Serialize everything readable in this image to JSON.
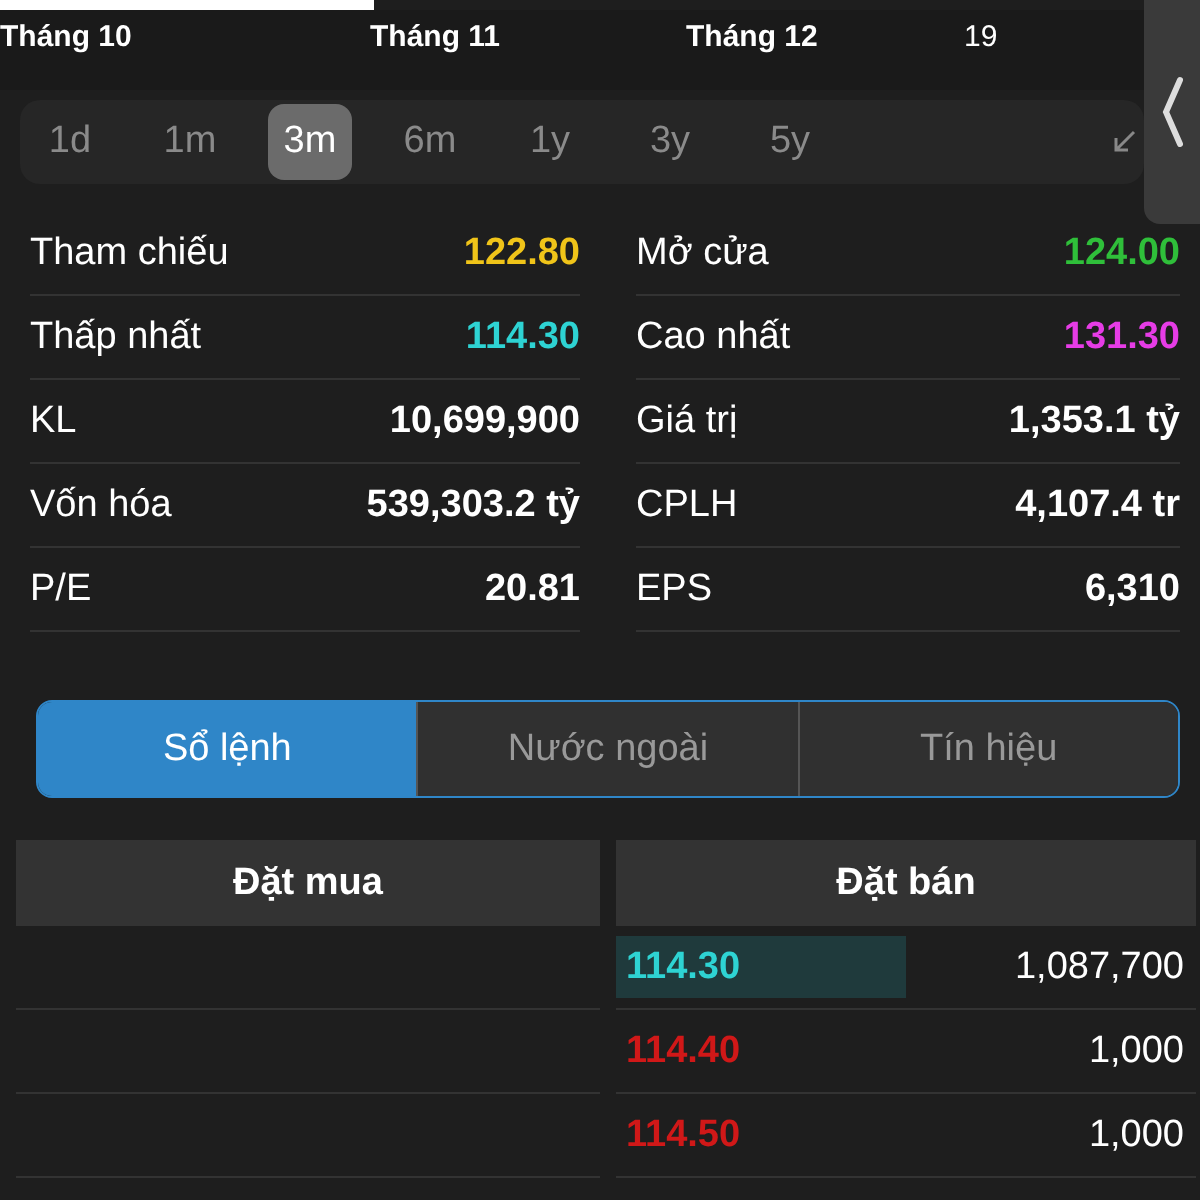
{
  "axis_labels": [
    {
      "label": "Tháng 10",
      "bold": true
    },
    {
      "label": "Tháng 11",
      "bold": true
    },
    {
      "label": "Tháng 12",
      "bold": true
    },
    {
      "label": "19",
      "bold": false
    }
  ],
  "ranges": [
    {
      "label": "1d",
      "selected": false
    },
    {
      "label": "1m",
      "selected": false
    },
    {
      "label": "3m",
      "selected": true
    },
    {
      "label": "6m",
      "selected": false
    },
    {
      "label": "1y",
      "selected": false
    },
    {
      "label": "3y",
      "selected": false
    },
    {
      "label": "5y",
      "selected": false
    }
  ],
  "stats": [
    {
      "label": "Tham chiếu",
      "value": "122.80",
      "color": "#f0c419"
    },
    {
      "label": "Mở cửa",
      "value": "124.00",
      "color": "#2fbf3a"
    },
    {
      "label": "Thấp nhất",
      "value": "114.30",
      "color": "#2ed3d3"
    },
    {
      "label": "Cao nhất",
      "value": "131.30",
      "color": "#e63ce6"
    },
    {
      "label": "KL",
      "value": "10,699,900",
      "color": "#ffffff"
    },
    {
      "label": "Giá trị",
      "value": "1,353.1 tỷ",
      "color": "#ffffff"
    },
    {
      "label": "Vốn hóa",
      "value": "539,303.2 tỷ",
      "color": "#ffffff"
    },
    {
      "label": "CPLH",
      "value": "4,107.4 tr",
      "color": "#ffffff"
    },
    {
      "label": "P/E",
      "value": "20.81",
      "color": "#ffffff"
    },
    {
      "label": "EPS",
      "value": "6,310",
      "color": "#ffffff"
    }
  ],
  "tabs": [
    {
      "label": "Sổ lệnh",
      "selected": true
    },
    {
      "label": "Nước ngoài",
      "selected": false
    },
    {
      "label": "Tín hiệu",
      "selected": false
    }
  ],
  "order_book": {
    "columns": [
      "Đặt mua",
      "Đặt bán"
    ],
    "asks": [
      {
        "price": "114.30",
        "volume": "1,087,700",
        "color": "#2ed3d3",
        "highlighted": true
      },
      {
        "price": "114.40",
        "volume": "1,000",
        "color": "#d01818",
        "highlighted": false
      },
      {
        "price": "114.50",
        "volume": "1,000",
        "color": "#d01818",
        "highlighted": false
      }
    ]
  }
}
